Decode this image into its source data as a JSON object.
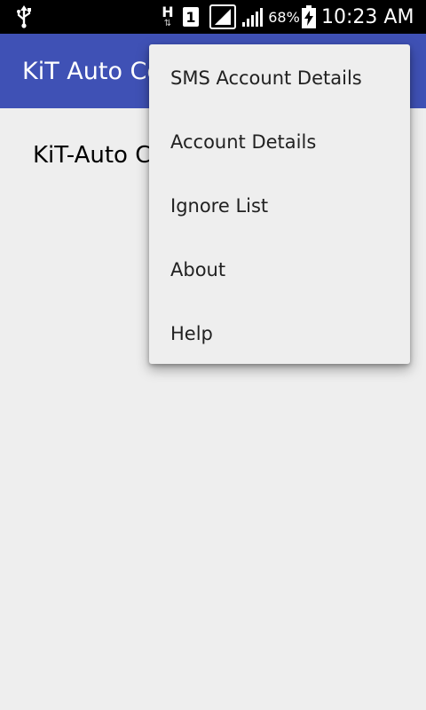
{
  "status_bar": {
    "network_type": "H",
    "sim_slot": "1",
    "battery_percent": "68%",
    "time": "10:23 AM",
    "icons": [
      "usb-icon",
      "data-transfer-icon",
      "sim-icon",
      "signal-icon",
      "signal-icon",
      "battery-charging-icon"
    ]
  },
  "app_bar": {
    "title": "KiT Auto Co",
    "color": "#3F51B5"
  },
  "main": {
    "heading": "KiT-Auto C"
  },
  "overflow_menu": {
    "items": [
      {
        "label": "SMS Account Details"
      },
      {
        "label": "Account Details"
      },
      {
        "label": "Ignore List"
      },
      {
        "label": "About"
      },
      {
        "label": "Help"
      }
    ]
  }
}
